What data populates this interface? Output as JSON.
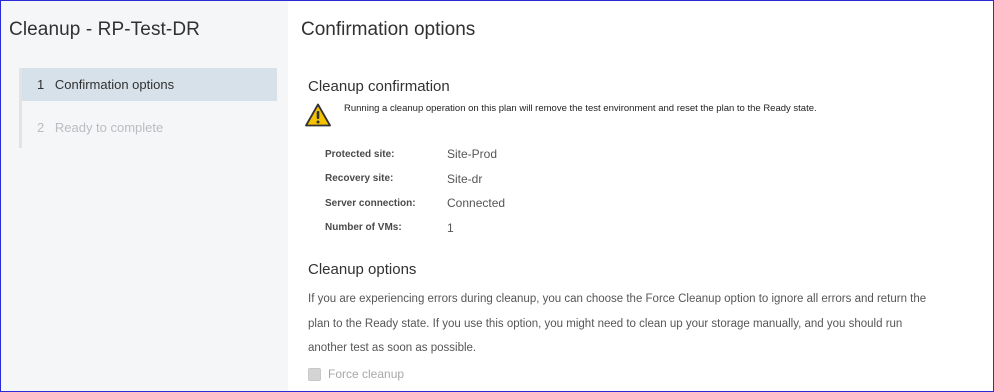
{
  "wizard": {
    "title": "Cleanup - RP-Test-DR",
    "steps": [
      {
        "number": "1",
        "label": "Confirmation options",
        "state": "active"
      },
      {
        "number": "2",
        "label": "Ready to complete",
        "state": "disabled"
      }
    ]
  },
  "page": {
    "title": "Confirmation options"
  },
  "confirmation": {
    "heading": "Cleanup confirmation",
    "warning_icon": "warning-triangle-icon",
    "warning_text": "Running a cleanup operation on this plan will remove the test environment and reset the plan to the Ready state.",
    "summary": [
      {
        "label": "Protected site:",
        "value": "Site-Prod"
      },
      {
        "label": "Recovery site:",
        "value": "Site-dr"
      },
      {
        "label": "Server connection:",
        "value": "Connected"
      },
      {
        "label": "Number of VMs:",
        "value": "1"
      }
    ]
  },
  "options": {
    "heading": "Cleanup options",
    "description_lines": [
      "If you are experiencing errors during cleanup, you can choose the Force Cleanup option to ignore all errors and return the",
      "plan to the Ready state. If you use this option, you might need to clean up your storage manually, and you should run",
      "another test as soon as possible."
    ],
    "force_cleanup_label": "Force cleanup",
    "force_cleanup_checked": false,
    "force_cleanup_enabled": false
  },
  "colors": {
    "sidebar_bg": "#f5f6f8",
    "active_step_bg": "#d7e1ea",
    "warning_yellow": "#f5c200",
    "frame_border": "#2b2bd6"
  }
}
